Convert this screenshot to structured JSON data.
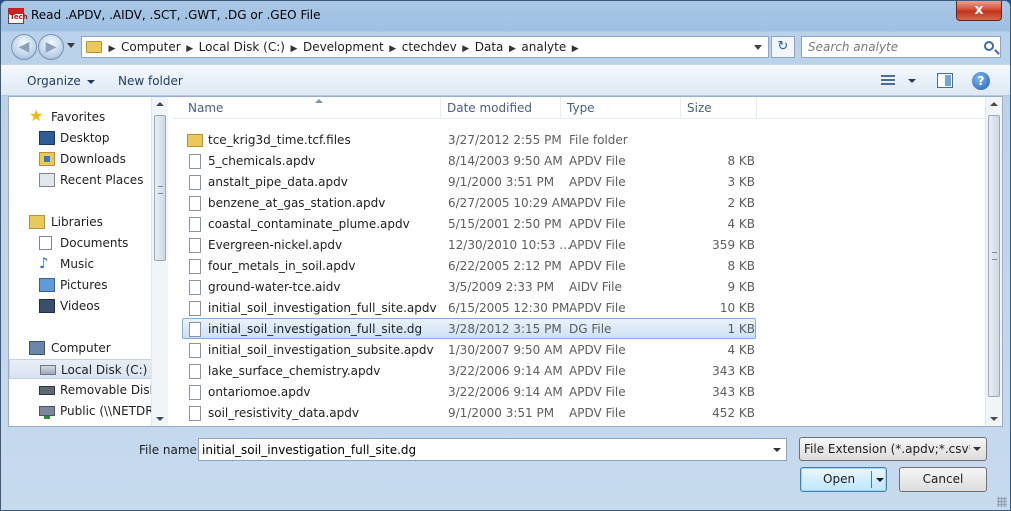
{
  "window": {
    "title": "Read .APDV, .AIDV, .SCT, .GWT, .DG or .GEO File",
    "app_icon_text": "Tech",
    "close_label": "x"
  },
  "address": {
    "crumbs": [
      "Computer",
      "Local Disk (C:)",
      "Development",
      "ctechdev",
      "Data",
      "analyte"
    ],
    "search_placeholder": "Search analyte"
  },
  "toolbar": {
    "organize_label": "Organize",
    "new_folder_label": "New folder",
    "help_label": "?"
  },
  "nav": {
    "items": [
      {
        "label": "Favorites",
        "icon": "star-icon",
        "group": true
      },
      {
        "label": "Desktop",
        "icon": "desktop-icon"
      },
      {
        "label": "Downloads",
        "icon": "downloads-icon"
      },
      {
        "label": "Recent Places",
        "icon": "recent-places-icon"
      },
      {
        "label": "Libraries",
        "icon": "libraries-icon",
        "group": true
      },
      {
        "label": "Documents",
        "icon": "documents-icon"
      },
      {
        "label": "Music",
        "icon": "music-icon"
      },
      {
        "label": "Pictures",
        "icon": "pictures-icon"
      },
      {
        "label": "Videos",
        "icon": "videos-icon"
      },
      {
        "label": "Computer",
        "icon": "computer-icon",
        "group": true
      },
      {
        "label": "Local Disk (C:)",
        "icon": "local-disk-icon",
        "selected": true
      },
      {
        "label": "Removable Disk (",
        "icon": "removable-disk-icon"
      },
      {
        "label": "Public (\\\\NETDRI",
        "icon": "network-drive-icon"
      }
    ]
  },
  "columns": {
    "name": "Name",
    "date": "Date modified",
    "type": "Type",
    "size": "Size"
  },
  "files": [
    {
      "name": "tce_krig3d_time.tcf.files",
      "date": "3/27/2012 2:55 PM",
      "type": "File folder",
      "size": "",
      "folder": true
    },
    {
      "name": "5_chemicals.apdv",
      "date": "8/14/2003 9:50 AM",
      "type": "APDV File",
      "size": "8 KB"
    },
    {
      "name": "anstalt_pipe_data.apdv",
      "date": "9/1/2000 3:51 PM",
      "type": "APDV File",
      "size": "3 KB"
    },
    {
      "name": "benzene_at_gas_station.apdv",
      "date": "6/27/2005 10:29 AM",
      "type": "APDV File",
      "size": "2 KB"
    },
    {
      "name": "coastal_contaminate_plume.apdv",
      "date": "5/15/2001 2:50 PM",
      "type": "APDV File",
      "size": "4 KB"
    },
    {
      "name": "Evergreen-nickel.apdv",
      "date": "12/30/2010 10:53 ...",
      "type": "APDV File",
      "size": "359 KB"
    },
    {
      "name": "four_metals_in_soil.apdv",
      "date": "6/22/2005 2:12 PM",
      "type": "APDV File",
      "size": "8 KB"
    },
    {
      "name": "ground-water-tce.aidv",
      "date": "3/5/2009 2:33 PM",
      "type": "AIDV File",
      "size": "9 KB"
    },
    {
      "name": "initial_soil_investigation_full_site.apdv",
      "date": "6/15/2005 12:30 PM",
      "type": "APDV File",
      "size": "10 KB"
    },
    {
      "name": "initial_soil_investigation_full_site.dg",
      "date": "3/28/2012 3:15 PM",
      "type": "DG File",
      "size": "1 KB",
      "selected": true
    },
    {
      "name": "initial_soil_investigation_subsite.apdv",
      "date": "1/30/2007 9:50 AM",
      "type": "APDV File",
      "size": "4 KB"
    },
    {
      "name": "lake_surface_chemistry.apdv",
      "date": "3/22/2006 9:14 AM",
      "type": "APDV File",
      "size": "343 KB"
    },
    {
      "name": "ontariomoe.apdv",
      "date": "3/22/2006 9:14 AM",
      "type": "APDV File",
      "size": "343 KB"
    },
    {
      "name": "soil_resistivity_data.apdv",
      "date": "9/1/2000 3:51 PM",
      "type": "APDV File",
      "size": "452 KB"
    }
  ],
  "bottom": {
    "file_name_label": "File name:",
    "file_name_value": "initial_soil_investigation_full_site.dg",
    "filter_value": "File Extension (*.apdv;*.csv*;*.ai",
    "open_label": "Open",
    "cancel_label": "Cancel"
  }
}
